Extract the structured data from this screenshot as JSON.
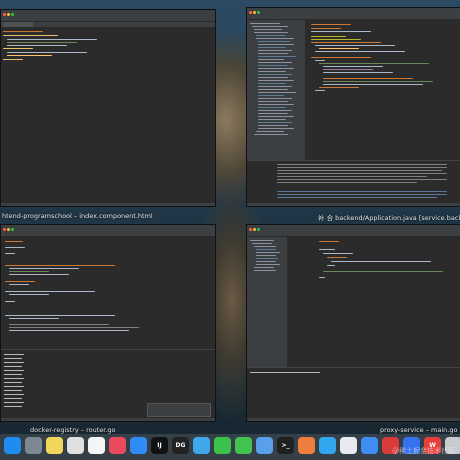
{
  "windows": {
    "top_left": {
      "caption": "htend-programschool – index.component.html"
    },
    "top_right": {
      "caption": "补 合 backend/Application.java [service.backe"
    },
    "bottom_left": {
      "caption": "docker-registry – router.go"
    },
    "bottom_right": {
      "caption": "proxy-service – main.go"
    }
  },
  "dock": {
    "apps": [
      {
        "name": "finder-icon",
        "glyph": "",
        "color": "#1f8cf0"
      },
      {
        "name": "launchpad-icon",
        "glyph": "",
        "color": "#7c8894"
      },
      {
        "name": "notes-icon",
        "glyph": "",
        "color": "#f2d65c"
      },
      {
        "name": "chrome-icon",
        "glyph": "",
        "color": "#e0e0e0"
      },
      {
        "name": "calendar-icon",
        "glyph": "",
        "color": "#f5f5f5"
      },
      {
        "name": "music-icon",
        "glyph": "",
        "color": "#e94a5c"
      },
      {
        "name": "appstore-icon",
        "glyph": "",
        "color": "#2f8cf7"
      },
      {
        "name": "intellij-icon",
        "glyph": "IJ",
        "color": "#111111"
      },
      {
        "name": "datagrip-icon",
        "glyph": "DG",
        "color": "#222222"
      },
      {
        "name": "goland-icon",
        "glyph": "",
        "color": "#3fa8ea"
      },
      {
        "name": "wechat-icon",
        "glyph": "",
        "color": "#3cc24b"
      },
      {
        "name": "messages-icon",
        "glyph": "",
        "color": "#42c350"
      },
      {
        "name": "pencil-icon",
        "glyph": "",
        "color": "#5aa0e8"
      },
      {
        "name": "terminal-icon",
        "glyph": ">_",
        "color": "#202020"
      },
      {
        "name": "postman-icon",
        "glyph": "",
        "color": "#ef7d3c"
      },
      {
        "name": "lark-icon",
        "glyph": "",
        "color": "#33a6f0"
      },
      {
        "name": "xmind-icon",
        "glyph": "",
        "color": "#e8eaf0"
      },
      {
        "name": "safari-icon",
        "glyph": "",
        "color": "#3f8df0"
      },
      {
        "name": "netease-icon",
        "glyph": "",
        "color": "#d93a3a"
      },
      {
        "name": "feishu-icon",
        "glyph": "",
        "color": "#3571f0"
      },
      {
        "name": "wps-icon",
        "glyph": "W",
        "color": "#e7403c"
      },
      {
        "name": "trash-icon",
        "glyph": "",
        "color": "#c8ccd0"
      }
    ]
  },
  "watermark": "@稀土掘金技术社区"
}
